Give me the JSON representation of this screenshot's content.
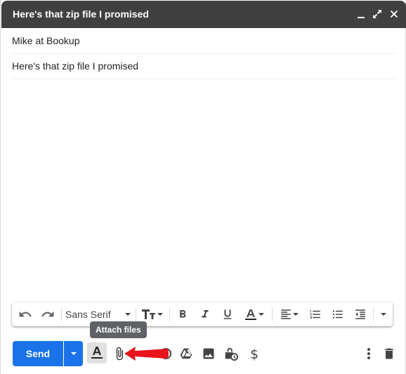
{
  "window": {
    "title": "Here's that zip file I promised",
    "controls": [
      "minimize-icon",
      "expand-icon",
      "close-icon"
    ]
  },
  "fields": {
    "recipient": "Mike at Bookup",
    "subject": "Here's that zip file I promised"
  },
  "formatting": {
    "font_name": "Sans Serif",
    "tools": [
      "undo-icon",
      "redo-icon",
      "font-dropdown",
      "text-size-icon",
      "bold-icon",
      "italic-icon",
      "underline-icon",
      "text-color-icon",
      "align-icon",
      "numbered-list-icon",
      "bulleted-list-icon",
      "indent-less-icon",
      "more-formatting-icon"
    ]
  },
  "footer": {
    "send_label": "Send",
    "tooltip": "Attach files"
  },
  "colors": {
    "titlebar": "#404040",
    "send_button": "#1a73e8",
    "annotation_arrow": "#e8141c",
    "tooltip_bg": "#5f6368"
  }
}
